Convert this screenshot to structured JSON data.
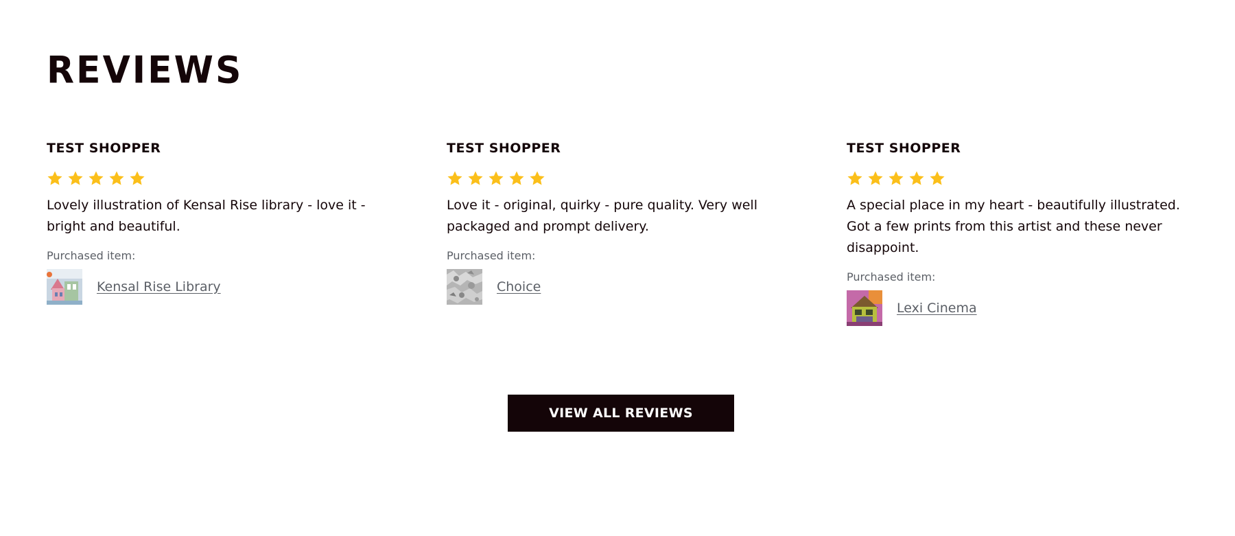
{
  "section": {
    "title": "REVIEWS"
  },
  "colors": {
    "text": "#140508",
    "muted": "#5b5f66",
    "star": "#fbbf1a",
    "button_bg": "#140508",
    "button_text": "#ffffff"
  },
  "reviews": [
    {
      "reviewer": "TEST SHOPPER",
      "rating": 5,
      "text": "Lovely illustration of Kensal Rise library - love it - bright and beautiful.",
      "purchased_label": "Purchased item:",
      "item_name": "Kensal Rise Library",
      "thumbnail_icon": "kensal-rise-library-thumbnail"
    },
    {
      "reviewer": "TEST SHOPPER",
      "rating": 5,
      "text": "Love it - original, quirky - pure quality. Very well packaged and prompt delivery.",
      "purchased_label": "Purchased item:",
      "item_name": "Choice",
      "thumbnail_icon": "choice-thumbnail"
    },
    {
      "reviewer": "TEST SHOPPER",
      "rating": 5,
      "text": "A special place in my heart - beautifully illustrated. Got a few prints from this artist and these never disappoint.",
      "purchased_label": "Purchased item:",
      "item_name": "Lexi Cinema",
      "thumbnail_icon": "lexi-cinema-thumbnail"
    }
  ],
  "view_all_button": {
    "label": "VIEW ALL REVIEWS"
  }
}
